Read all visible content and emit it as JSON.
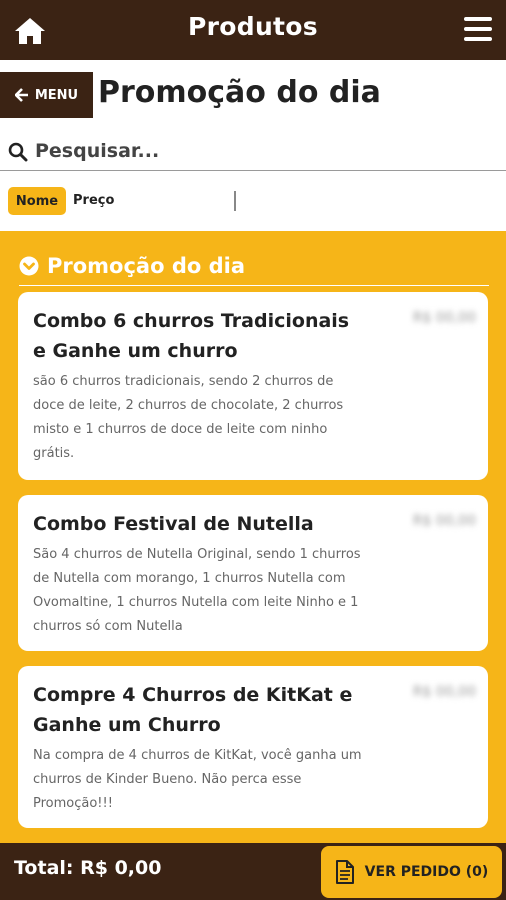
{
  "header": {
    "title": "Produtos",
    "home_icon": "home-icon",
    "menu_icon": "hamburger-icon"
  },
  "nav": {
    "menu_label": "MENU",
    "page_title": "Promoção do dia"
  },
  "search": {
    "placeholder": "Pesquisar..."
  },
  "sort": {
    "options": [
      "Nome",
      "Preço"
    ],
    "active": "Nome"
  },
  "section": {
    "title": "Promoção do dia"
  },
  "products": [
    {
      "name": "Combo 6 churros Tradicionais e Ganhe um churro",
      "description": "são 6 churros tradicionais, sendo 2 churros de doce de leite, 2 churros de chocolate, 2 churros misto e 1 churros de doce de leite com ninho grátis.",
      "price": "R$ 00,00"
    },
    {
      "name": "Combo Festival de Nutella",
      "description": "São 4 churros de Nutella Original, sendo 1 churros de Nutella com morango, 1 churros Nutella com Ovomaltine, 1 churros Nutella com leite Ninho e 1 churros só com Nutella",
      "price": "R$ 00,00"
    },
    {
      "name": "Compre 4 Churros de KitKat e Ganhe um Churro",
      "description": "Na compra de 4 churros de KitKat, você ganha um churros de Kinder Bueno. Não perca esse Promoção!!!",
      "price": "R$ 00,00"
    }
  ],
  "footer": {
    "total": "Total: R$ 0,00",
    "order_button": "VER PEDIDO (0)"
  },
  "colors": {
    "brown": "#3b2314",
    "yellow": "#f6b518"
  }
}
